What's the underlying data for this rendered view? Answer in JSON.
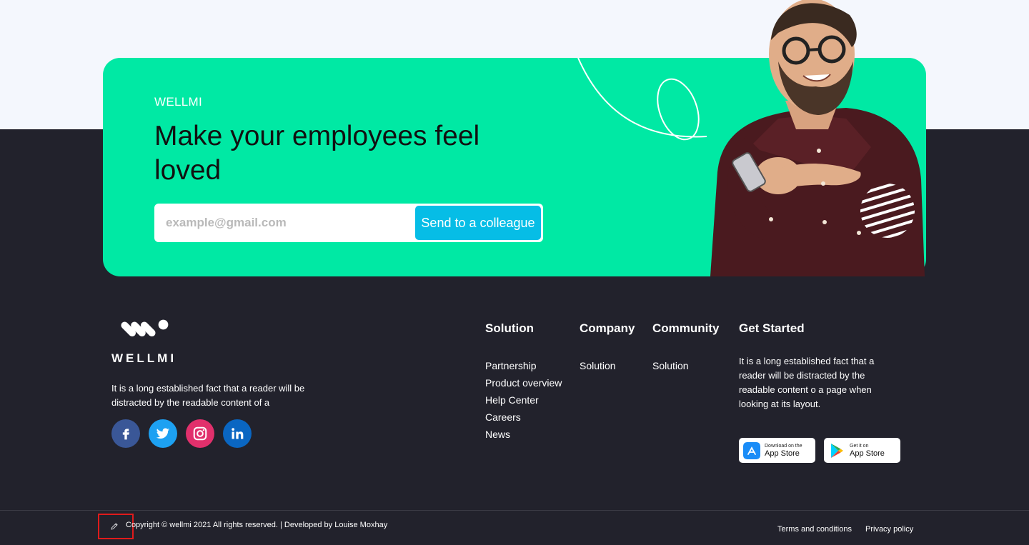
{
  "cta": {
    "eyebrow": "WELLMI",
    "title": "Make your employees feel loved",
    "input_placeholder": "example@gmail.com",
    "button_label": "Send to a colleague"
  },
  "brand": {
    "logo_text": "WELLMI",
    "about": "It is a long established fact that a reader will be distracted by the readable content of a"
  },
  "socials": [
    "facebook",
    "twitter",
    "instagram",
    "linkedin"
  ],
  "columns": {
    "solution": {
      "heading": "Solution",
      "items": [
        "Partnership",
        "Product overview",
        "Help Center",
        "Careers",
        "News"
      ]
    },
    "company": {
      "heading": "Company",
      "items": [
        "Solution"
      ]
    },
    "community": {
      "heading": "Community",
      "items": [
        "Solution"
      ]
    },
    "get_started": {
      "heading": "Get Started",
      "text": "It is a long established fact that a reader will be distracted by the readable content o a page when looking at its layout."
    }
  },
  "stores": {
    "apple": {
      "small": "Download on the",
      "big": "App Store"
    },
    "google": {
      "small": "Get it on",
      "big": "App Store"
    }
  },
  "bottom": {
    "copyright": "Copyright © wellmi 2021 All rights reserved. | Developed by Louise Moxhay",
    "terms": "Terms and conditions",
    "privacy": "Privacy policy"
  },
  "colors": {
    "accent": "#00e9a4",
    "button": "#06bde6",
    "footer": "#22222c",
    "top_band": "#f4f7fd"
  }
}
